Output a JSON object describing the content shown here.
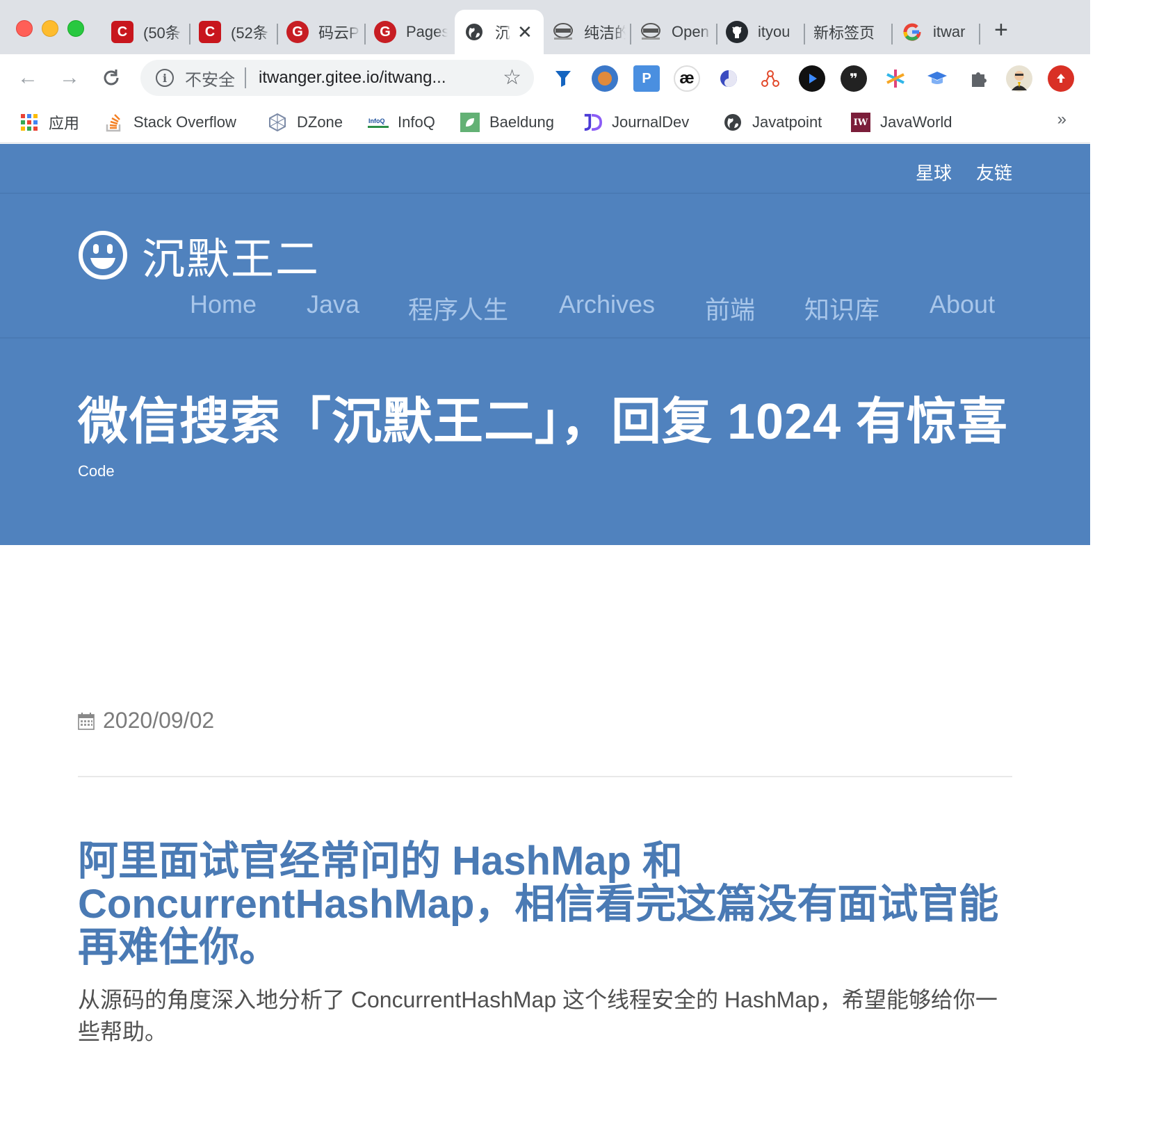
{
  "tabs": [
    {
      "label": "(50条",
      "icon": "csdn-icon",
      "color": "#c8161d",
      "glyph": "C"
    },
    {
      "label": "(52条",
      "icon": "csdn-icon",
      "color": "#c8161d",
      "glyph": "C"
    },
    {
      "label": "码云P",
      "icon": "gitee-icon",
      "color": "#c71d23",
      "glyph": "G"
    },
    {
      "label": "Pages",
      "icon": "gitee-icon",
      "color": "#c71d23",
      "glyph": "G"
    },
    {
      "label": "沉",
      "icon": "globe-icon",
      "color": "#3c4043",
      "glyph": ""
    },
    {
      "label": "纯洁的",
      "icon": "ninja-icon",
      "color": "#777777",
      "glyph": ""
    },
    {
      "label": "Open",
      "icon": "ninja-icon",
      "color": "#777777",
      "glyph": ""
    },
    {
      "label": "ityou",
      "icon": "github-icon",
      "color": "#24292e",
      "glyph": ""
    },
    {
      "label": "新标签页",
      "icon": "",
      "color": "",
      "glyph": ""
    },
    {
      "label": "itwar",
      "icon": "google-icon",
      "color": "#4285f4",
      "glyph": "G"
    }
  ],
  "toolbar": {
    "insecure_label": "不安全",
    "url": "itwanger.gitee.io/itwang..."
  },
  "bookmarks": [
    {
      "label": "应用",
      "icon": "apps-grid-icon"
    },
    {
      "label": "Stack Overflow",
      "icon": "stackoverflow-icon"
    },
    {
      "label": "DZone",
      "icon": "dzone-icon"
    },
    {
      "label": "InfoQ",
      "icon": "infoq-icon"
    },
    {
      "label": "Baeldung",
      "icon": "baeldung-icon"
    },
    {
      "label": "JournalDev",
      "icon": "journaldev-icon"
    },
    {
      "label": "Javatpoint",
      "icon": "globe-icon"
    },
    {
      "label": "JavaWorld",
      "icon": "javaworld-icon"
    }
  ],
  "bookmarks_more": "»",
  "site": {
    "top_links": [
      "星球",
      "友链"
    ],
    "brand": "沉默王二",
    "nav": [
      "Home",
      "Java",
      "程序人生",
      "Archives",
      "前端",
      "知识库",
      "About"
    ],
    "headline": "微信搜索「沉默王二」，回复 1024 有惊喜",
    "subtag": "Code"
  },
  "post": {
    "date": "2020/09/02",
    "title": "阿里面试官经常问的 HashMap 和 ConcurrentHashMap，相信看完这篇没有面试官能再难住你。",
    "summary": "从源码的角度深入地分析了 ConcurrentHashMap 这个线程安全的 HashMap，希望能够给你一些帮助。"
  },
  "colors": {
    "hero_bg": "#5082be",
    "nav_link": "#a8c6ea",
    "post_title": "#4a7ab4"
  }
}
